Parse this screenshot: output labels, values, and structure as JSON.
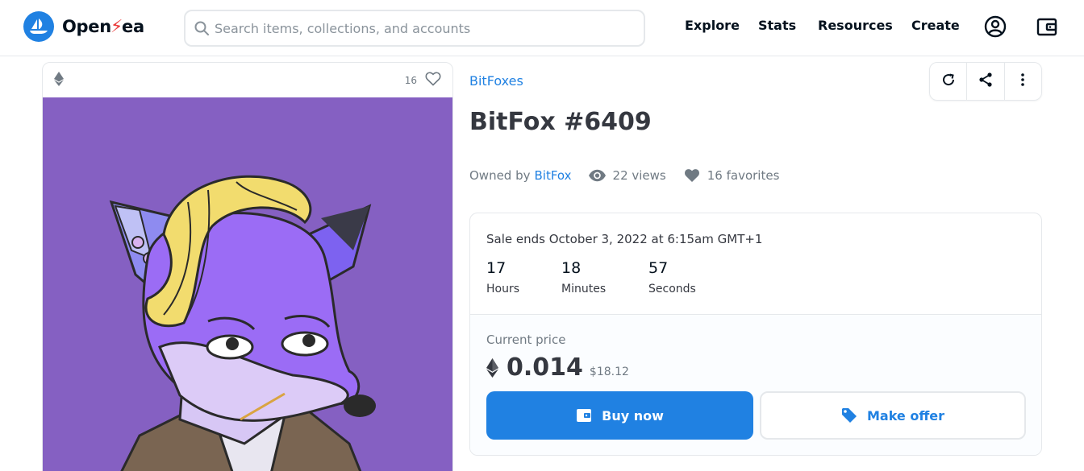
{
  "brand": {
    "name_prefix": "Open",
    "name_bolt": "⚡",
    "name_suffix": "ea",
    "logo_icon": "sailboat-icon",
    "accent": "#2081e2"
  },
  "search": {
    "placeholder": "Search items, collections, and accounts",
    "value": "",
    "icon": "search-icon"
  },
  "nav": {
    "items": [
      {
        "label": "Explore"
      },
      {
        "label": "Stats"
      },
      {
        "label": "Resources"
      },
      {
        "label": "Create"
      }
    ],
    "profile_icon": "account-circle-icon",
    "wallet_icon": "wallet-icon"
  },
  "card": {
    "chain_icon": "ethereum-icon",
    "favorite_count": "16",
    "favorite_icon": "heart-outline-icon",
    "image_background": "#8560c2"
  },
  "item": {
    "collection": "BitFoxes",
    "title": "BitFox #6409",
    "owned_by_label": "Owned by",
    "owner": "BitFox",
    "views": "22 views",
    "favorites": "16 favorites",
    "actions": [
      "refresh-icon",
      "share-icon",
      "more-vertical-icon"
    ]
  },
  "sale": {
    "ends_text": "Sale ends October 3, 2022 at 6:15am GMT+1",
    "countdown": [
      {
        "value": "17",
        "label": "Hours"
      },
      {
        "value": "18",
        "label": "Minutes"
      },
      {
        "value": "57",
        "label": "Seconds"
      }
    ],
    "current_price_label": "Current price",
    "price_eth": "0.014",
    "price_usd": "$18.12",
    "buy_label": "Buy now",
    "offer_label": "Make offer"
  }
}
